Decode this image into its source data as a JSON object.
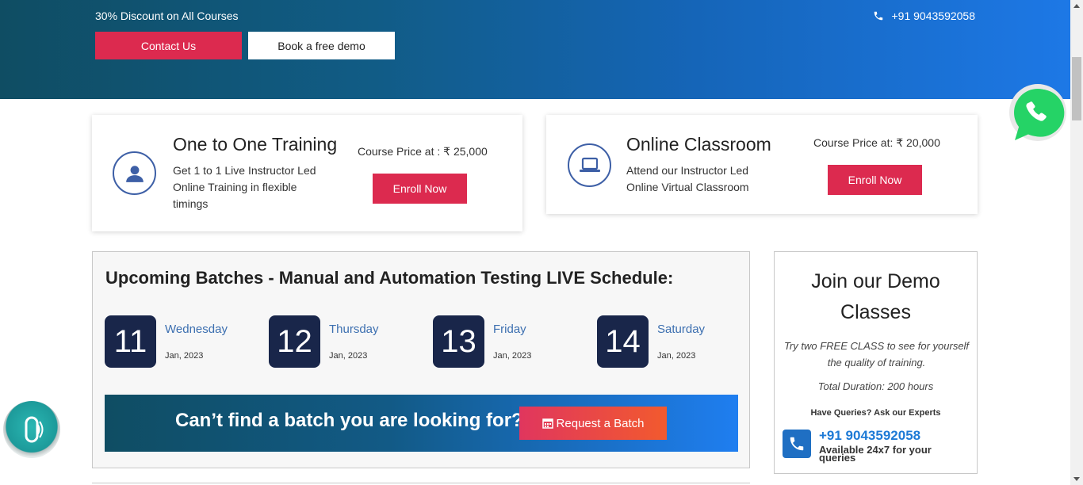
{
  "hero": {
    "promo": "30% Discount on All Courses",
    "contact_label": "Contact Us",
    "demo_label": "Book a free demo",
    "phone": "+91 9043592058"
  },
  "cards": [
    {
      "title": "One to One Training",
      "description": "Get 1 to 1 Live Instructor Led Online Training in flexible timings",
      "price": "Course Price at : ₹ 25,000",
      "button": "Enroll Now",
      "icon": "user-icon"
    },
    {
      "title": "Online Classroom",
      "description": "Attend our Instructor Led Online Virtual Classroom",
      "price": "Course Price at: ₹ 20,000",
      "button": "Enroll Now",
      "icon": "laptop-icon"
    }
  ],
  "batches": {
    "heading": "Upcoming Batches - Manual and Automation Testing LIVE Schedule:",
    "dates": [
      {
        "num": "11",
        "day": "Wednesday",
        "month": "Jan, 2023"
      },
      {
        "num": "12",
        "day": "Thursday",
        "month": "Jan, 2023"
      },
      {
        "num": "13",
        "day": "Friday",
        "month": "Jan, 2023"
      },
      {
        "num": "14",
        "day": "Saturday",
        "month": "Jan, 2023"
      }
    ],
    "cta_text": "Can’t find a batch you are looking for?",
    "request_label": "Request a Batch"
  },
  "demo": {
    "title": "Join our Demo Classes",
    "tagline": "Try two FREE CLASS to see for yourself the quality of training.",
    "duration": "Total Duration: 200 hours",
    "queries": "Have Queries? Ask our Experts",
    "phone": "+91 9043592058",
    "availability": "Available 24x7 for your queries"
  },
  "colors": {
    "accent": "#dc2a4f",
    "date_box": "#19264a",
    "link_blue": "#3c6fb0",
    "whatsapp_green": "#25d366"
  }
}
